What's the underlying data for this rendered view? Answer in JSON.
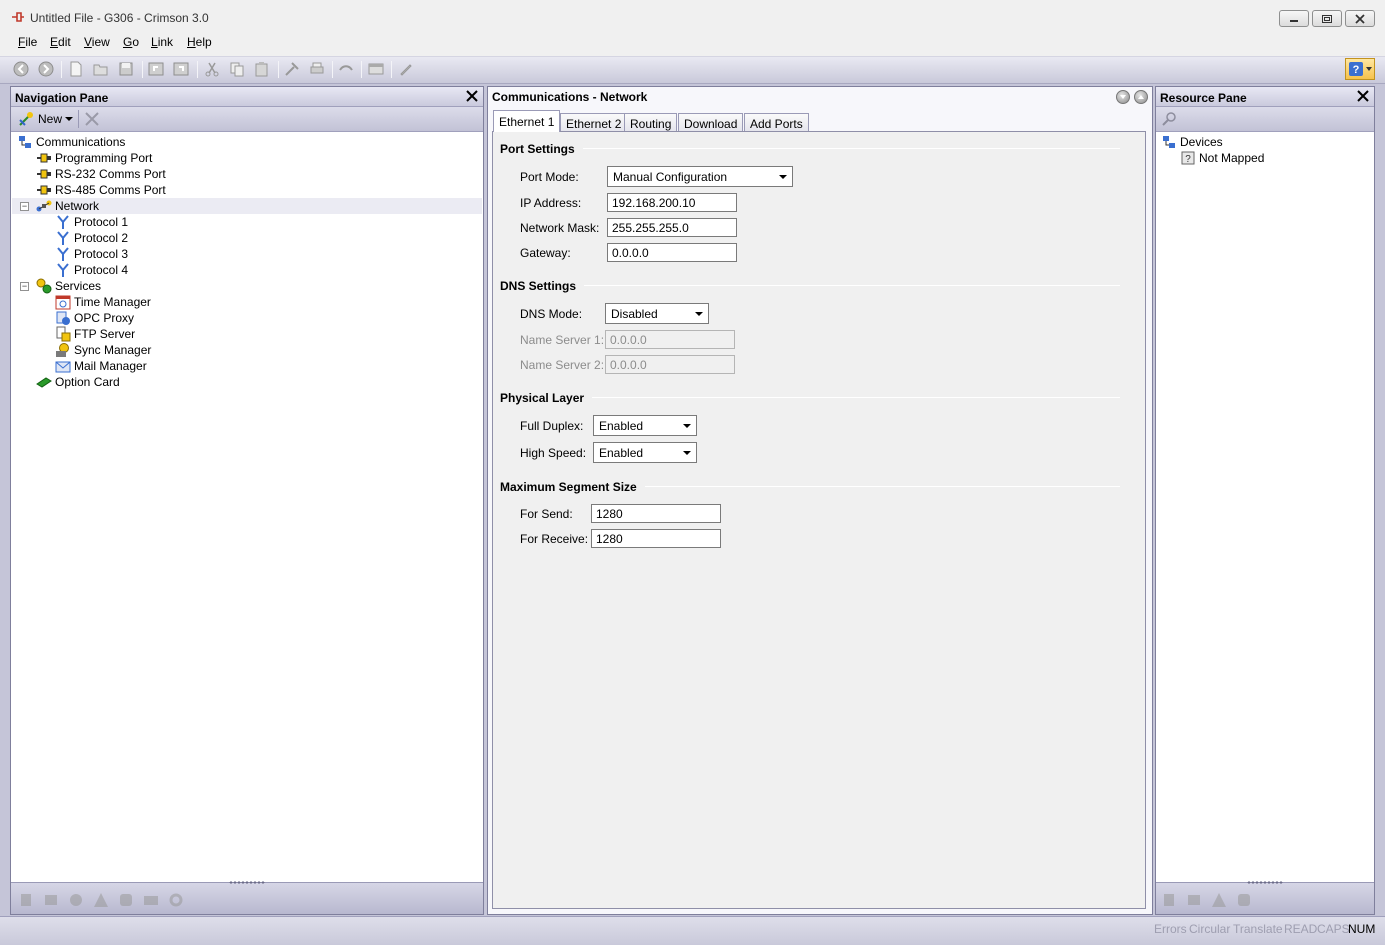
{
  "window": {
    "title": "Untitled File - G306 - Crimson 3.0"
  },
  "menu": {
    "items": [
      {
        "key": "F",
        "rest": "ile"
      },
      {
        "key": "E",
        "rest": "dit"
      },
      {
        "key": "V",
        "rest": "iew"
      },
      {
        "key": "G",
        "rest": "o"
      },
      {
        "key": "L",
        "rest": "ink"
      },
      {
        "key": "H",
        "rest": "elp"
      }
    ]
  },
  "toolbar": {
    "icons": [
      "back-icon",
      "forward-icon",
      "new-file-icon",
      "open-icon",
      "save-icon",
      "undo-icon",
      "redo-icon",
      "cut-icon",
      "copy-icon",
      "paste-icon",
      "tools-icon",
      "print-icon",
      "link-icon",
      "window-icon",
      "pen-icon",
      "help-icon"
    ]
  },
  "navigation": {
    "title": "Navigation Pane",
    "new_label": "New",
    "tree": [
      {
        "label": "Communications",
        "icon": "communications-icon",
        "level": 0
      },
      {
        "label": "Programming Port",
        "icon": "port-icon",
        "level": 1
      },
      {
        "label": "RS-232 Comms Port",
        "icon": "port-icon",
        "level": 1
      },
      {
        "label": "RS-485 Comms Port",
        "icon": "port-icon",
        "level": 1
      },
      {
        "label": "Network",
        "icon": "network-icon",
        "level": 1
      },
      {
        "label": "Protocol 1",
        "icon": "protocol-icon",
        "level": 2
      },
      {
        "label": "Protocol 2",
        "icon": "protocol-icon",
        "level": 2
      },
      {
        "label": "Protocol 3",
        "icon": "protocol-icon",
        "level": 2
      },
      {
        "label": "Protocol 4",
        "icon": "protocol-icon",
        "level": 2
      },
      {
        "label": "Services",
        "icon": "services-icon",
        "level": 1
      },
      {
        "label": "Time Manager",
        "icon": "time-manager-icon",
        "level": 2
      },
      {
        "label": "OPC Proxy",
        "icon": "opc-proxy-icon",
        "level": 2
      },
      {
        "label": "FTP Server",
        "icon": "ftp-server-icon",
        "level": 2
      },
      {
        "label": "Sync Manager",
        "icon": "sync-manager-icon",
        "level": 2
      },
      {
        "label": "Mail Manager",
        "icon": "mail-manager-icon",
        "level": 2
      },
      {
        "label": "Option Card",
        "icon": "option-card-icon",
        "level": 1
      }
    ]
  },
  "editor": {
    "title": "Communications - Network",
    "tabs": [
      "Ethernet 1",
      "Ethernet 2",
      "Routing",
      "Download",
      "Add Ports"
    ],
    "active_tab": "Ethernet 1",
    "port_settings": {
      "title": "Port Settings",
      "port_mode_label": "Port Mode:",
      "port_mode_value": "Manual Configuration",
      "ip_label": "IP Address:",
      "ip_value": "192.168.200.10",
      "mask_label": "Network Mask:",
      "mask_value": "255.255.255.0",
      "gateway_label": "Gateway:",
      "gateway_value": "0.0.0.0"
    },
    "dns_settings": {
      "title": "DNS Settings",
      "mode_label": "DNS Mode:",
      "mode_value": "Disabled",
      "ns1_label": "Name Server 1:",
      "ns1_value": "0.0.0.0",
      "ns2_label": "Name Server 2:",
      "ns2_value": "0.0.0.0"
    },
    "physical_layer": {
      "title": "Physical Layer",
      "full_duplex_label": "Full Duplex:",
      "full_duplex_value": "Enabled",
      "high_speed_label": "High Speed:",
      "high_speed_value": "Enabled"
    },
    "segment_size": {
      "title": "Maximum Segment Size",
      "send_label": "For Send:",
      "send_value": "1280",
      "receive_label": "For Receive:",
      "receive_value": "1280"
    }
  },
  "resources": {
    "title": "Resource Pane",
    "tree": [
      {
        "label": "Devices",
        "icon": "devices-icon",
        "level": 0
      },
      {
        "label": "Not Mapped",
        "icon": "unknown-icon",
        "level": 1
      }
    ]
  },
  "status": {
    "errors": "Errors",
    "circular": "Circular",
    "translate": "Translate",
    "read": "READ",
    "caps": "CAPS",
    "num": "NUM"
  },
  "colors": {
    "workspace": "#c5c5d8",
    "panel": "#f0f0f0",
    "help_button": "#f6c24c"
  }
}
